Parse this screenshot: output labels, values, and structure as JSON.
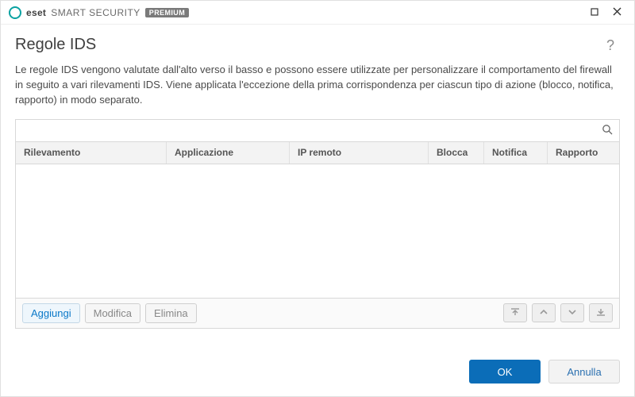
{
  "brand": {
    "eset": "eset",
    "name": "SMART SECURITY",
    "tier": "PREMIUM"
  },
  "page": {
    "title": "Regole IDS",
    "description": "Le regole IDS vengono valutate dall'alto verso il basso e possono essere utilizzate per personalizzare il comportamento del firewall in seguito a vari rilevamenti IDS. Viene applicata l'eccezione della prima corrispondenza per ciascun tipo di azione (blocco, notifica, rapporto) in modo separato."
  },
  "search": {
    "placeholder": ""
  },
  "table": {
    "columns": {
      "detection": "Rilevamento",
      "application": "Applicazione",
      "remote_ip": "IP remoto",
      "block": "Blocca",
      "notify": "Notifica",
      "report": "Rapporto"
    },
    "rows": []
  },
  "toolbar": {
    "add": "Aggiungi",
    "edit": "Modifica",
    "delete": "Elimina"
  },
  "footer": {
    "ok": "OK",
    "cancel": "Annulla"
  },
  "help": "?"
}
